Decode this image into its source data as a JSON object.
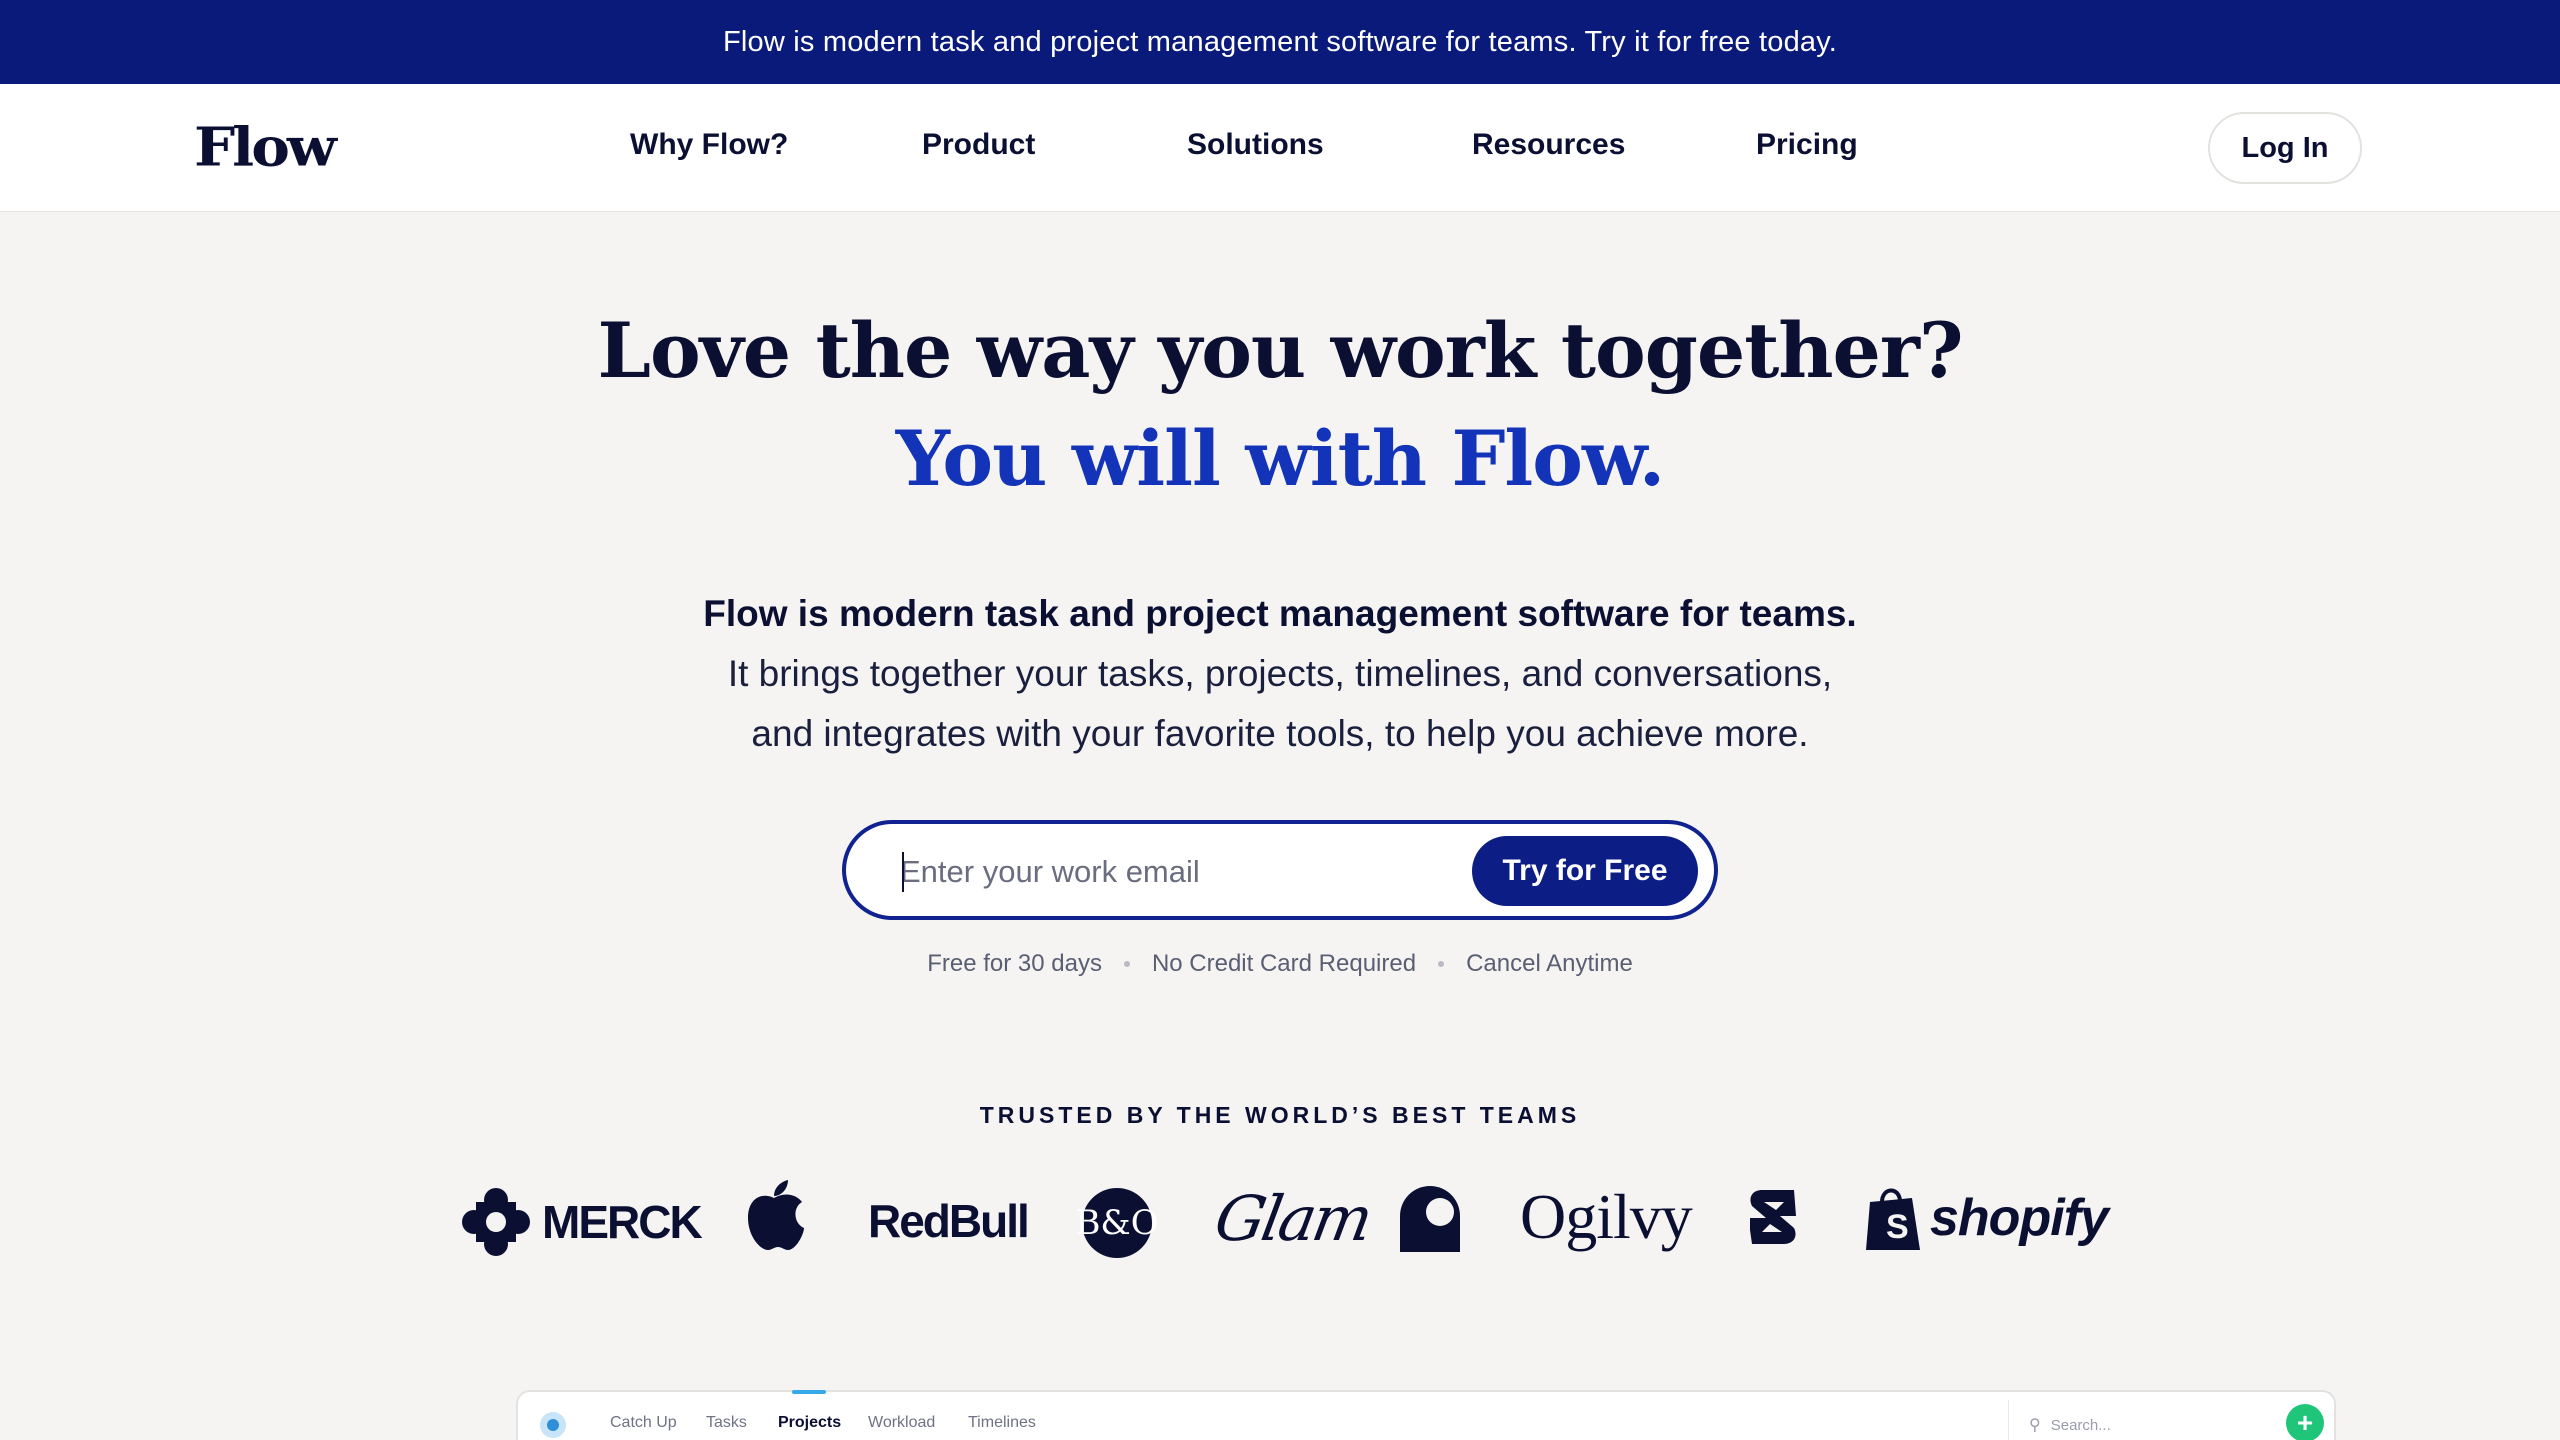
{
  "announcement": "Flow is modern task and project management software for teams. Try it for free today.",
  "header": {
    "logo": "Flow",
    "nav": [
      "Why Flow?",
      "Product",
      "Solutions",
      "Resources",
      "Pricing"
    ],
    "login_label": "Log In"
  },
  "hero": {
    "line1": "Love the way you work together?",
    "line2": "You will with Flow."
  },
  "subtitle": {
    "line1": "Flow is modern task and project management software for teams.",
    "line2": "It brings together your tasks, projects, timelines, and conversations,",
    "line3": "and integrates with your favorite tools, to help you achieve more."
  },
  "signup": {
    "placeholder": "Enter your work email",
    "button": "Try for Free",
    "perks": [
      "Free for 30 days",
      "No Credit Card Required",
      "Cancel Anytime"
    ]
  },
  "trusted_heading": "TRUSTED BY THE WORLD’S BEST TEAMS",
  "logos": {
    "merck": "MERCK",
    "apple": "apple-logo",
    "redbull": "RedBull",
    "bo": "B&O",
    "glam": "Glam",
    "carhartt": "carhartt-logo",
    "ogilvy": "Ogilvy",
    "s_logo": "S",
    "shopify": "shopify"
  },
  "preview": {
    "tabs": [
      "Catch Up",
      "Tasks",
      "Projects",
      "Workload",
      "Timelines"
    ],
    "active_tab": "Projects",
    "search_placeholder": "Search...",
    "add_label": "+"
  },
  "colors": {
    "brand_navy": "#0a1a7a",
    "accent_blue": "#1333b8",
    "add_green": "#1fc67a"
  }
}
